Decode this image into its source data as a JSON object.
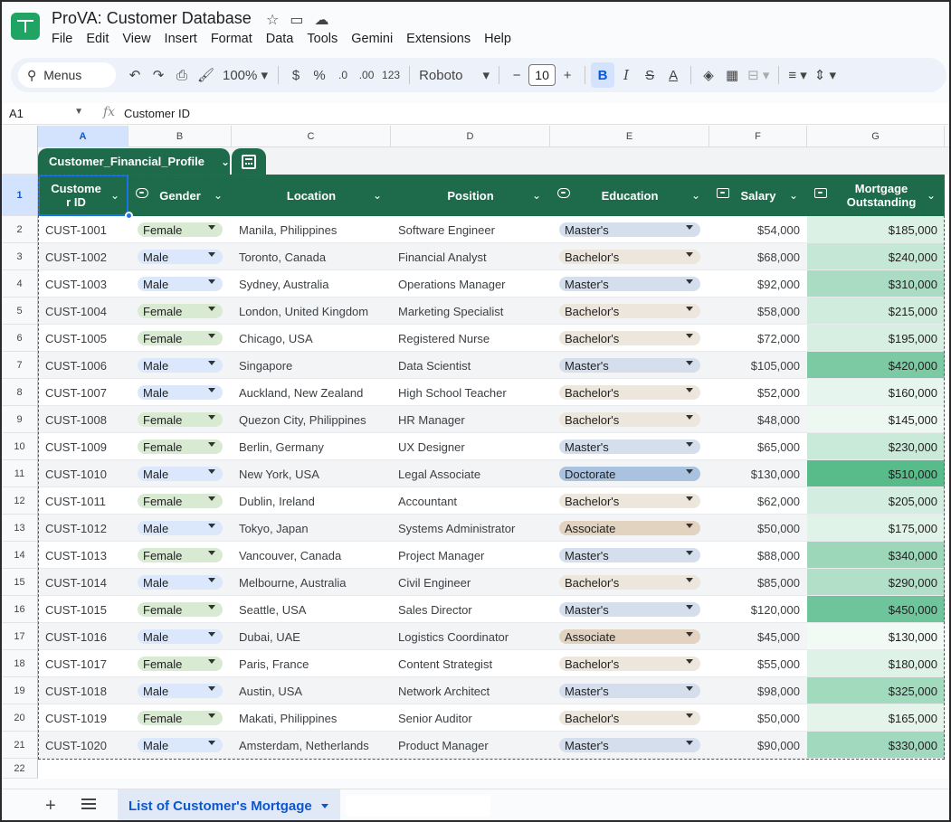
{
  "app": {
    "title": "ProVA: Customer Database",
    "menus": [
      "File",
      "Edit",
      "View",
      "Insert",
      "Format",
      "Data",
      "Tools",
      "Gemini",
      "Extensions",
      "Help"
    ]
  },
  "toolbar": {
    "search_label": "Menus",
    "zoom": "100%",
    "currency": "$",
    "percent": "%",
    "dec_decrease": ".0",
    "dec_increase": ".00",
    "number_format": "123",
    "font": "Roboto",
    "font_size": "10",
    "bold": "B",
    "italic": "I",
    "strike": "S",
    "text_color": "A"
  },
  "formula_bar": {
    "cell_ref": "A1",
    "fx": "fx",
    "value": "Customer ID"
  },
  "columns": [
    "A",
    "B",
    "C",
    "D",
    "E",
    "F",
    "G"
  ],
  "table": {
    "name": "Customer_Financial_Profile",
    "headers": [
      "Custome r ID",
      "Gender",
      "Location",
      "Position",
      "Education",
      "Salary",
      "Mortgage Outstanding"
    ]
  },
  "rows": [
    {
      "n": "2",
      "id": "CUST-1001",
      "gender": "Female",
      "location": "Manila, Philippines",
      "position": "Software Engineer",
      "education": "Master's",
      "salary": "$54,000",
      "mortgage": "$185,000",
      "mval": 185000
    },
    {
      "n": "3",
      "id": "CUST-1002",
      "gender": "Male",
      "location": "Toronto, Canada",
      "position": "Financial Analyst",
      "education": "Bachelor's",
      "salary": "$68,000",
      "mortgage": "$240,000",
      "mval": 240000
    },
    {
      "n": "4",
      "id": "CUST-1003",
      "gender": "Male",
      "location": "Sydney, Australia",
      "position": "Operations Manager",
      "education": "Master's",
      "salary": "$92,000",
      "mortgage": "$310,000",
      "mval": 310000
    },
    {
      "n": "5",
      "id": "CUST-1004",
      "gender": "Female",
      "location": "London, United Kingdom",
      "position": "Marketing Specialist",
      "education": "Bachelor's",
      "salary": "$58,000",
      "mortgage": "$215,000",
      "mval": 215000
    },
    {
      "n": "6",
      "id": "CUST-1005",
      "gender": "Female",
      "location": "Chicago, USA",
      "position": "Registered Nurse",
      "education": "Bachelor's",
      "salary": "$72,000",
      "mortgage": "$195,000",
      "mval": 195000
    },
    {
      "n": "7",
      "id": "CUST-1006",
      "gender": "Male",
      "location": "Singapore",
      "position": "Data Scientist",
      "education": "Master's",
      "salary": "$105,000",
      "mortgage": "$420,000",
      "mval": 420000
    },
    {
      "n": "8",
      "id": "CUST-1007",
      "gender": "Male",
      "location": "Auckland, New Zealand",
      "position": "High School Teacher",
      "education": "Bachelor's",
      "salary": "$52,000",
      "mortgage": "$160,000",
      "mval": 160000
    },
    {
      "n": "9",
      "id": "CUST-1008",
      "gender": "Female",
      "location": "Quezon City, Philippines",
      "position": "HR Manager",
      "education": "Bachelor's",
      "salary": "$48,000",
      "mortgage": "$145,000",
      "mval": 145000
    },
    {
      "n": "10",
      "id": "CUST-1009",
      "gender": "Female",
      "location": "Berlin, Germany",
      "position": "UX Designer",
      "education": "Master's",
      "salary": "$65,000",
      "mortgage": "$230,000",
      "mval": 230000
    },
    {
      "n": "11",
      "id": "CUST-1010",
      "gender": "Male",
      "location": "New York, USA",
      "position": "Legal Associate",
      "education": "Doctorate",
      "salary": "$130,000",
      "mortgage": "$510,000",
      "mval": 510000
    },
    {
      "n": "12",
      "id": "CUST-1011",
      "gender": "Female",
      "location": "Dublin, Ireland",
      "position": "Accountant",
      "education": "Bachelor's",
      "salary": "$62,000",
      "mortgage": "$205,000",
      "mval": 205000
    },
    {
      "n": "13",
      "id": "CUST-1012",
      "gender": "Male",
      "location": "Tokyo, Japan",
      "position": "Systems Administrator",
      "education": "Associate",
      "salary": "$50,000",
      "mortgage": "$175,000",
      "mval": 175000
    },
    {
      "n": "14",
      "id": "CUST-1013",
      "gender": "Female",
      "location": "Vancouver, Canada",
      "position": "Project Manager",
      "education": "Master's",
      "salary": "$88,000",
      "mortgage": "$340,000",
      "mval": 340000
    },
    {
      "n": "15",
      "id": "CUST-1014",
      "gender": "Male",
      "location": "Melbourne, Australia",
      "position": "Civil Engineer",
      "education": "Bachelor's",
      "salary": "$85,000",
      "mortgage": "$290,000",
      "mval": 290000
    },
    {
      "n": "16",
      "id": "CUST-1015",
      "gender": "Female",
      "location": "Seattle, USA",
      "position": "Sales Director",
      "education": "Master's",
      "salary": "$120,000",
      "mortgage": "$450,000",
      "mval": 450000
    },
    {
      "n": "17",
      "id": "CUST-1016",
      "gender": "Male",
      "location": "Dubai, UAE",
      "position": "Logistics Coordinator",
      "education": "Associate",
      "salary": "$45,000",
      "mortgage": "$130,000",
      "mval": 130000
    },
    {
      "n": "18",
      "id": "CUST-1017",
      "gender": "Female",
      "location": "Paris, France",
      "position": "Content Strategist",
      "education": "Bachelor's",
      "salary": "$55,000",
      "mortgage": "$180,000",
      "mval": 180000
    },
    {
      "n": "19",
      "id": "CUST-1018",
      "gender": "Male",
      "location": "Austin, USA",
      "position": "Network Architect",
      "education": "Master's",
      "salary": "$98,000",
      "mortgage": "$325,000",
      "mval": 325000
    },
    {
      "n": "20",
      "id": "CUST-1019",
      "gender": "Female",
      "location": "Makati, Philippines",
      "position": "Senior Auditor",
      "education": "Bachelor's",
      "salary": "$50,000",
      "mortgage": "$165,000",
      "mval": 165000
    },
    {
      "n": "21",
      "id": "CUST-1020",
      "gender": "Male",
      "location": "Amsterdam, Netherlands",
      "position": "Product Manager",
      "education": "Master's",
      "salary": "$90,000",
      "mortgage": "$330,000",
      "mval": 330000
    }
  ],
  "header_row_num": "1",
  "empty_row_num": "22",
  "colors": {
    "table_header": "#1e6b4c",
    "chip_female": "#d9ead3",
    "chip_male": "#dbe7fb",
    "chip_masters": "#d5deed",
    "chip_bachelors": "#ece6dc",
    "chip_doctorate": "#a8c2e0",
    "chip_associate": "#e2d2c0",
    "heat_low": "#f2faf5",
    "heat_high": "#57bb8a"
  },
  "sheet_tab": "List of Customer's Mortgage"
}
